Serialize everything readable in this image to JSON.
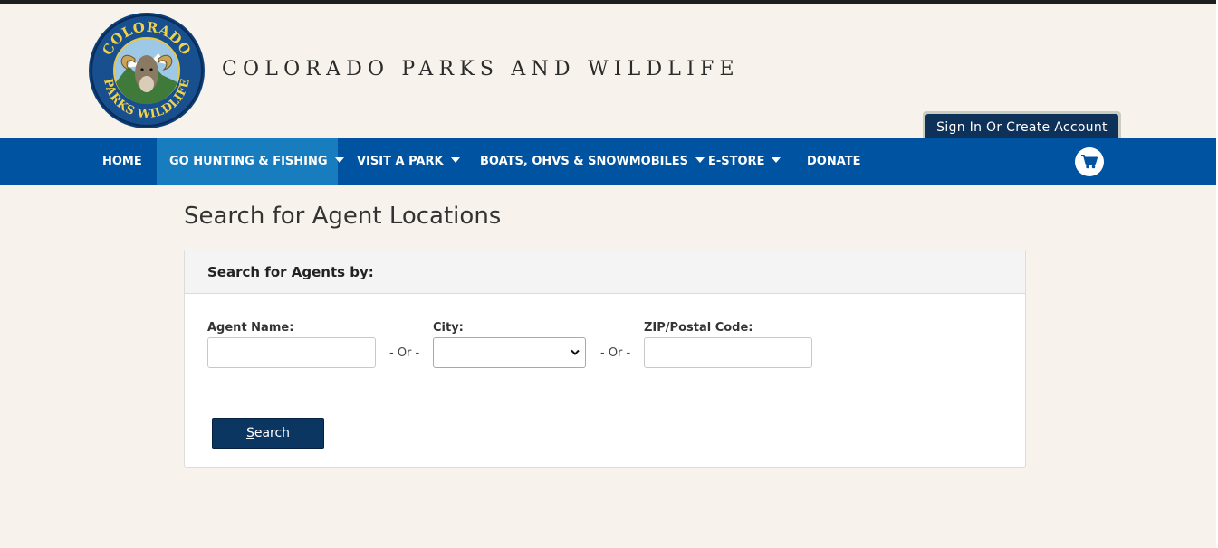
{
  "header": {
    "site_title": "COLORADO PARKS AND WILDLIFE",
    "logo_top_text": "COLORADO",
    "logo_bottom_text": "PARKS WILDLIFE",
    "signin_label": "Sign In Or Create Account"
  },
  "nav": {
    "items": [
      {
        "label": "HOME",
        "has_dropdown": false
      },
      {
        "label": "GO HUNTING & FISHING",
        "has_dropdown": true,
        "active": true
      },
      {
        "label": "VISIT A PARK",
        "has_dropdown": true
      },
      {
        "label": "BOATS, OHVS & SNOWMOBILES",
        "has_dropdown": true
      },
      {
        "label": "E-STORE",
        "has_dropdown": true
      },
      {
        "label": "DONATE",
        "has_dropdown": false
      }
    ],
    "cart_icon": "cart-icon"
  },
  "main": {
    "page_title": "Search for Agent Locations",
    "panel_heading": "Search for Agents by:",
    "fields": {
      "agent_name_label": "Agent Name:",
      "agent_name_value": "",
      "city_label": "City:",
      "city_value": "",
      "zip_label": "ZIP/Postal Code:",
      "zip_value": ""
    },
    "or_separator": "- Or -",
    "search_button": {
      "accesskey_letter": "S",
      "rest": "earch"
    }
  },
  "colors": {
    "nav_bg": "#0053a0",
    "nav_active_bg": "#177dbf",
    "button_bg": "#0c3662",
    "page_bg": "#f7f3ec"
  }
}
